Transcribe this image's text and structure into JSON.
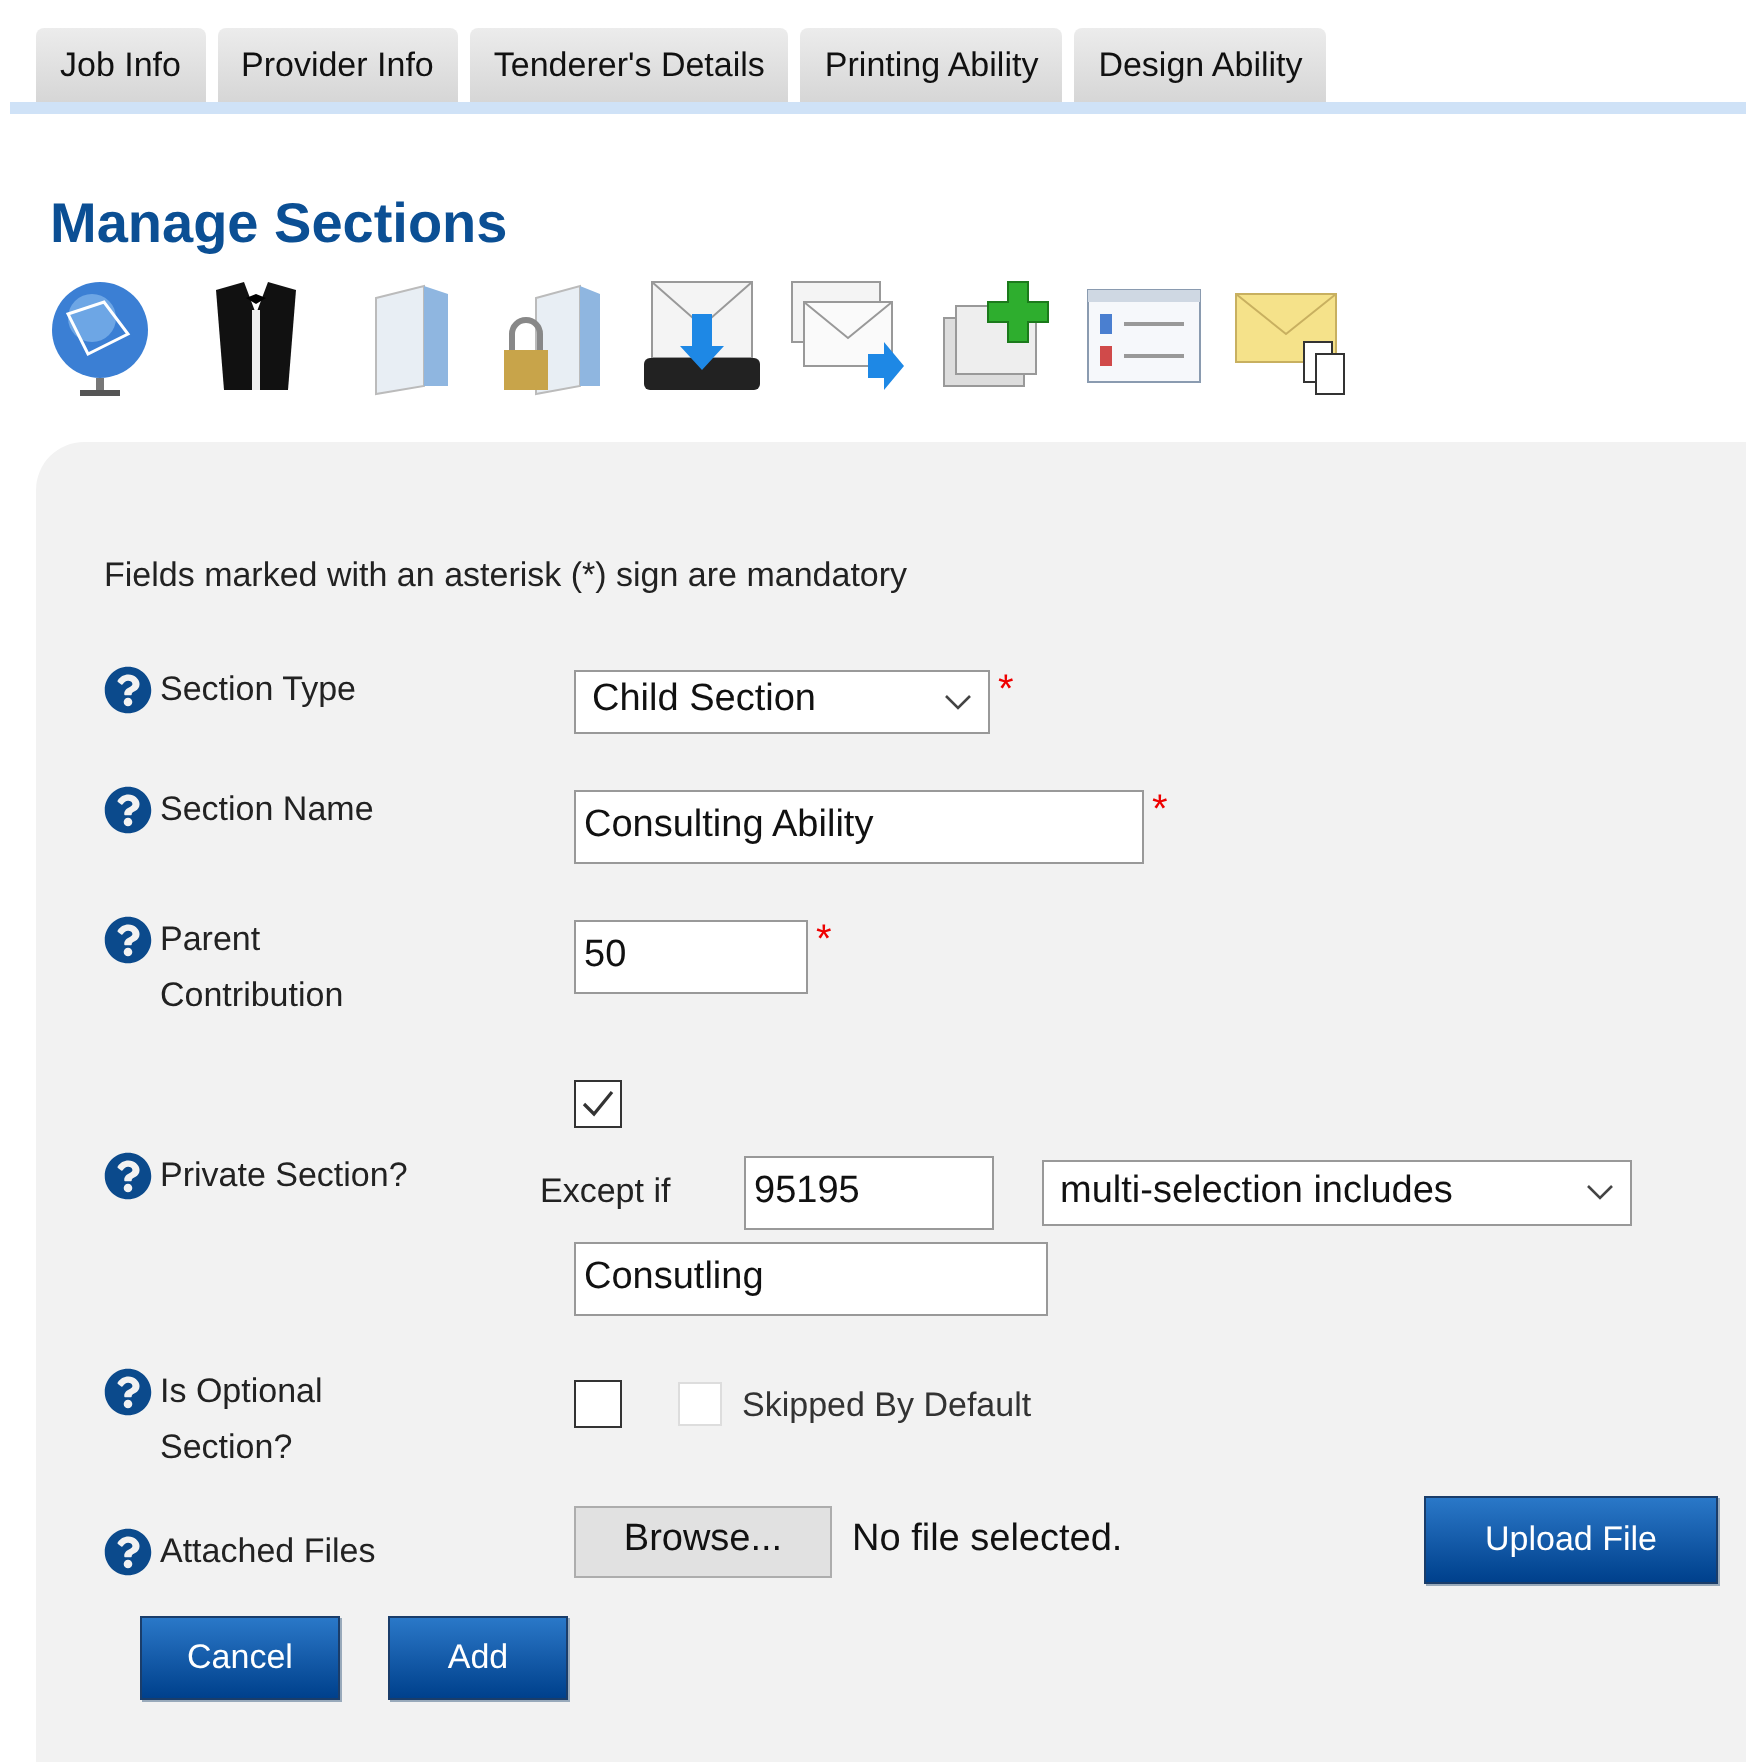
{
  "tabs": [
    {
      "label": "Job Info",
      "selected": false
    },
    {
      "label": "Provider Info",
      "selected": false
    },
    {
      "label": "Tenderer's Details",
      "selected": false
    },
    {
      "label": "Printing Ability",
      "selected": false
    },
    {
      "label": "Design Ability",
      "selected": false
    }
  ],
  "title": "Manage Sections",
  "notice": "Fields marked with an asterisk (*) sign are mandatory",
  "fields": [
    {
      "kind": "select",
      "label": "Section Type",
      "value": "Child Section",
      "required_mark": "*"
    },
    {
      "kind": "text",
      "label": "Section Name",
      "value": "Consulting Ability",
      "required_mark": "*"
    },
    {
      "kind": "text",
      "label": "Parent Contribution",
      "value": "50",
      "required_mark": "*"
    },
    {
      "kind": "private",
      "label": "Private Section?",
      "checked": true,
      "except_label": "Except if",
      "except_value": "95195",
      "condition": "multi-selection includes",
      "condition_value": "Consutling"
    },
    {
      "kind": "optional",
      "label": "Is Optional Section?",
      "checked": false,
      "skipped": {
        "label": "Skipped By Default",
        "checked": false,
        "disabled": true
      }
    },
    {
      "kind": "files",
      "label": "Attached Files",
      "browse": "Browse...",
      "status": "No file selected.",
      "upload": "Upload File"
    }
  ],
  "buttons": [
    "Cancel",
    "Add"
  ]
}
